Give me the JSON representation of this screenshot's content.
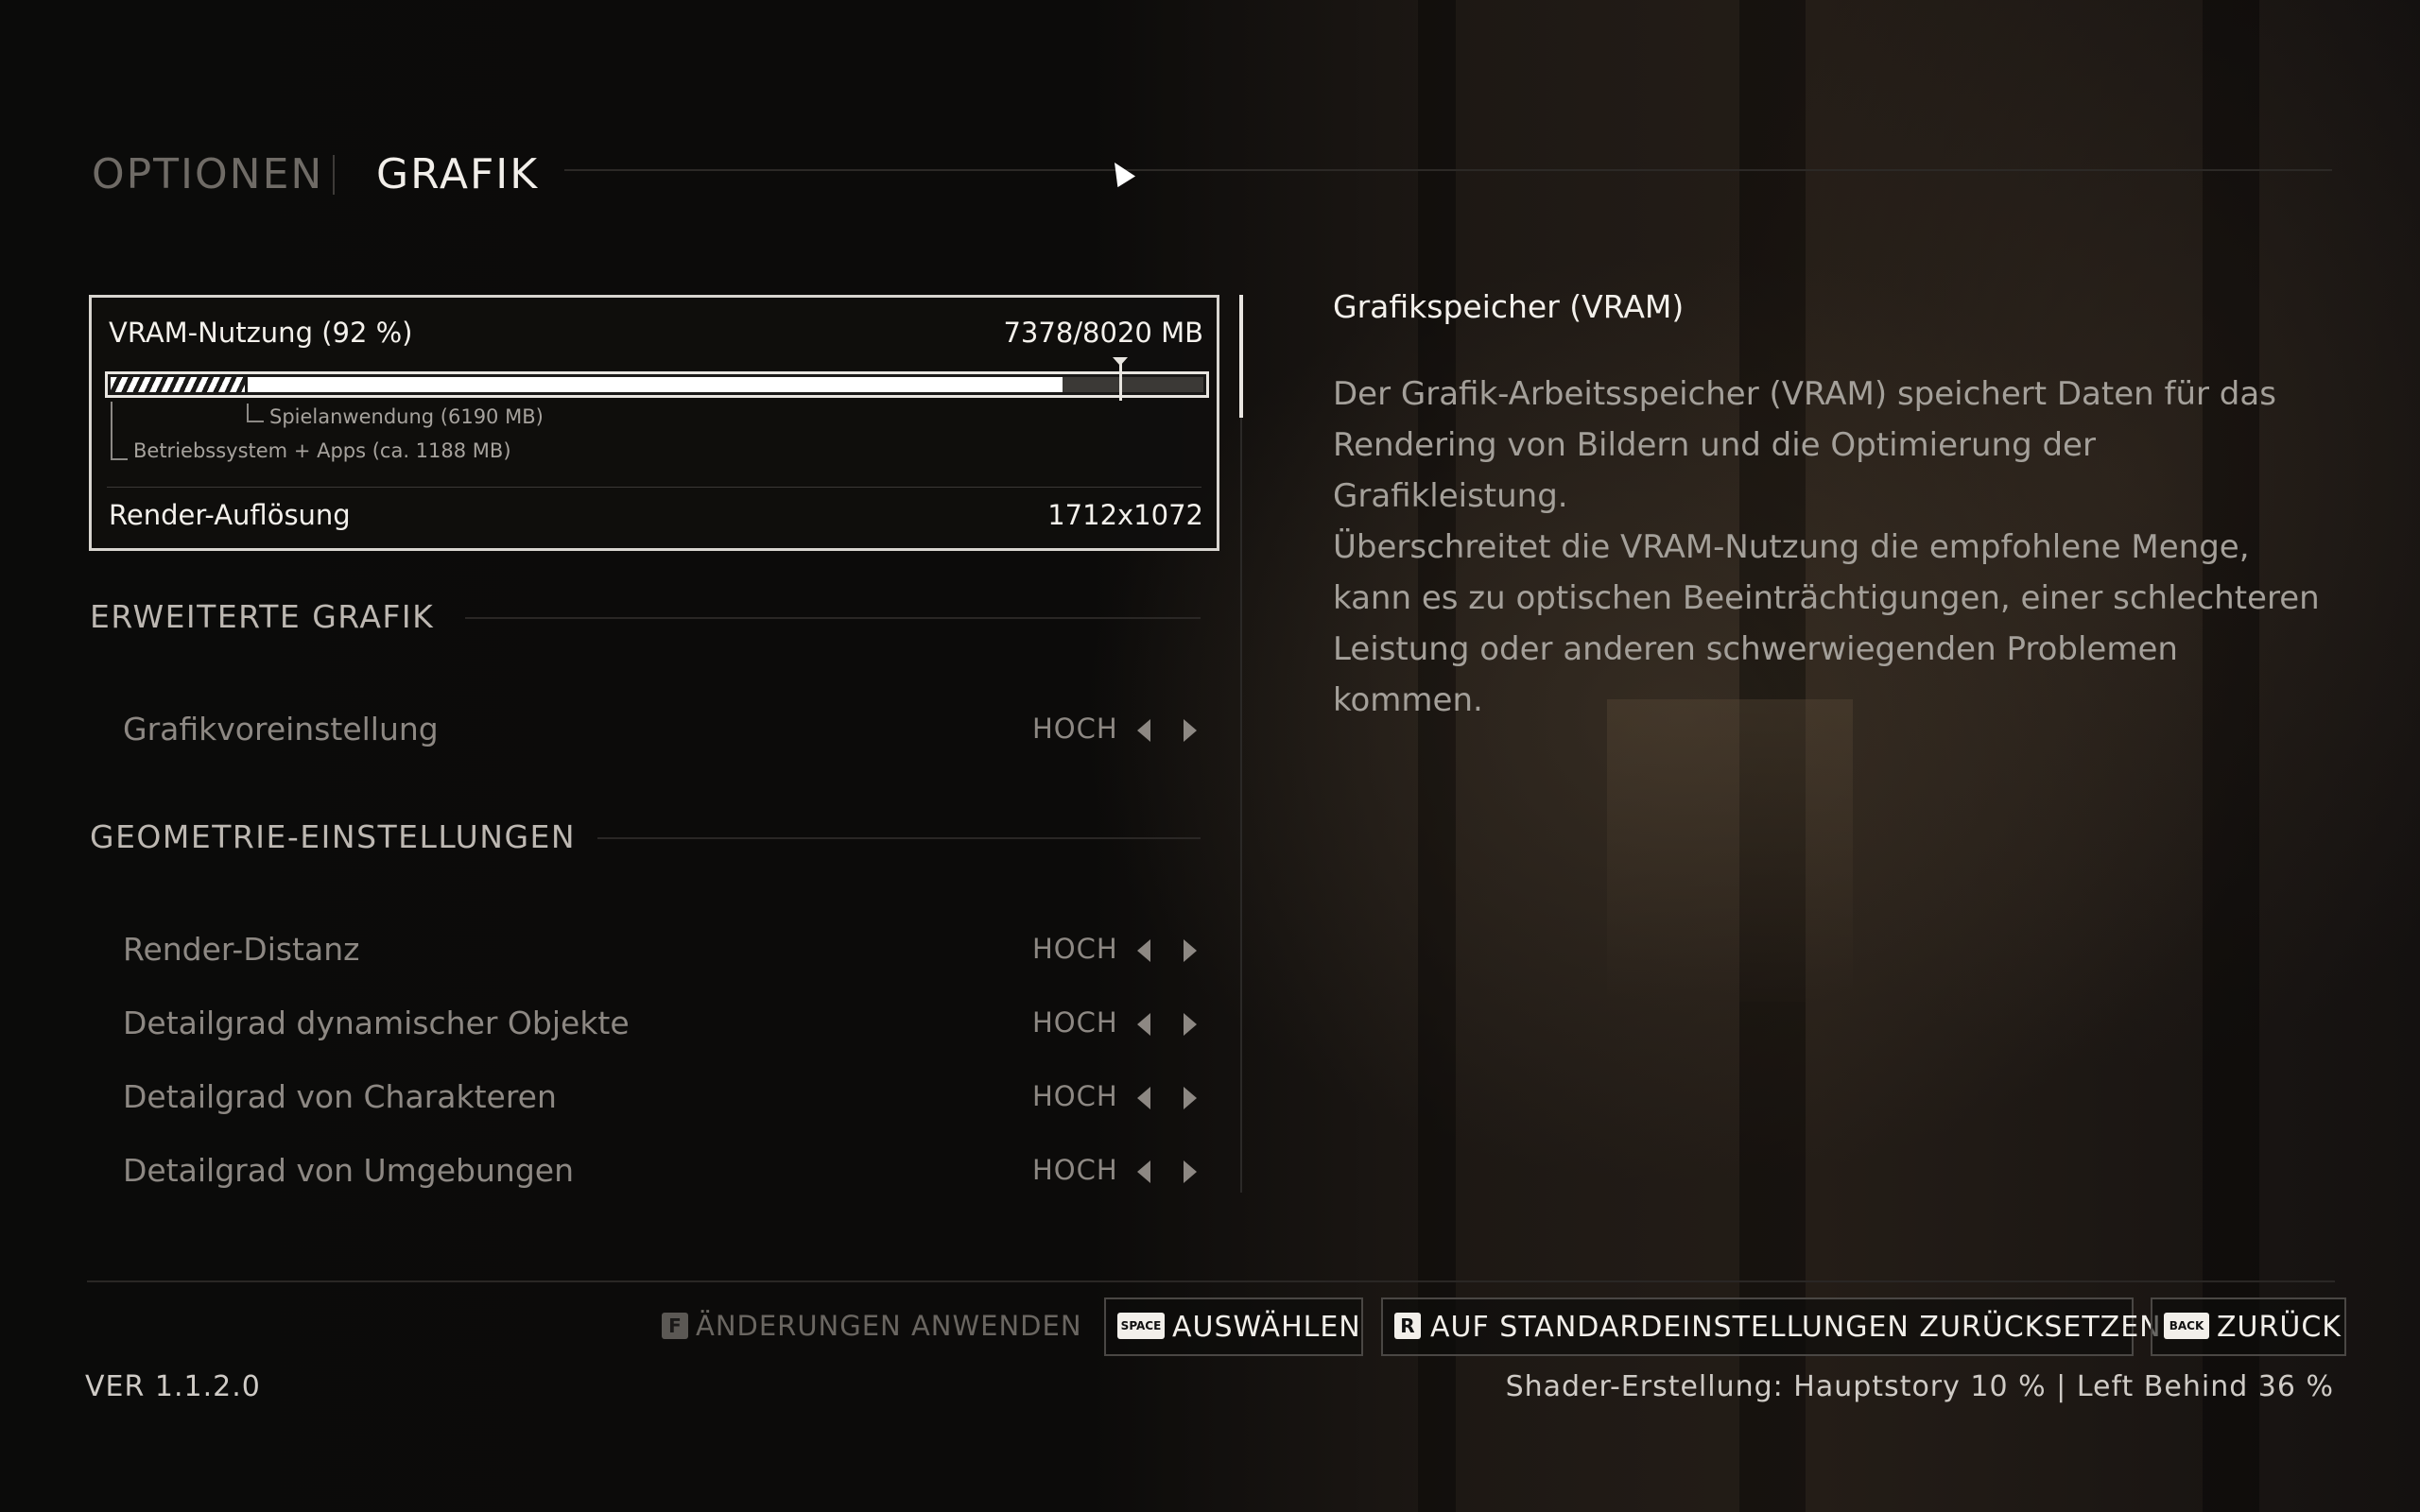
{
  "header": {
    "tabs": [
      {
        "label": "OPTIONEN",
        "active": false
      },
      {
        "label": "GRAFIK",
        "active": true
      }
    ]
  },
  "vram": {
    "title": "VRAM-Nutzung (92 %)",
    "value": "7378/8020 MB",
    "legend_game": "Spielanwendung (6190 MB)",
    "legend_os": "Betriebssystem + Apps (ca. 1188 MB)",
    "usage_fraction": 0.92,
    "resolution_label": "Render-Auflösung",
    "resolution_value": "1712x1072"
  },
  "sections": [
    {
      "title": "ERWEITERTE GRAFIK",
      "settings": [
        {
          "label": "Grafikvoreinstellung",
          "value": "HOCH"
        }
      ]
    },
    {
      "title": "GEOMETRIE-EINSTELLUNGEN",
      "settings": [
        {
          "label": "Render-Distanz",
          "value": "HOCH"
        },
        {
          "label": "Detailgrad dynamischer Objekte",
          "value": "HOCH"
        },
        {
          "label": "Detailgrad von Charakteren",
          "value": "HOCH"
        },
        {
          "label": "Detailgrad von Umgebungen",
          "value": "HOCH"
        }
      ]
    }
  ],
  "description": {
    "title": "Grafikspeicher (VRAM)",
    "paragraphs": [
      "Der Grafik-Arbeitsspeicher (VRAM) speichert Daten für das Rendering von Bildern und die Optimierung der Grafikleistung.",
      "Überschreitet die VRAM-Nutzung die empfohlene Menge, kann es zu optischen Beeinträchtigungen, einer schlechteren Leistung oder anderen schwerwiegenden Problemen kommen."
    ]
  },
  "footer": {
    "apply": {
      "key": "F",
      "label": "ÄNDERUNGEN ANWENDEN"
    },
    "select": {
      "key": "SPACE",
      "label": "AUSWÄHLEN"
    },
    "reset": {
      "key": "R",
      "label": "AUF STANDARDEINSTELLUNGEN ZURÜCKSETZEN"
    },
    "back": {
      "key": "BACK",
      "label": "ZURÜCK"
    },
    "version": "VER 1.1.2.0",
    "shader_status": "Shader-Erstellung: Hauptstory 10 % | Left Behind 36 %"
  },
  "colors": {
    "accent": "#f2efea",
    "dim_text": "#8d8883",
    "background": "#0b0a09"
  }
}
